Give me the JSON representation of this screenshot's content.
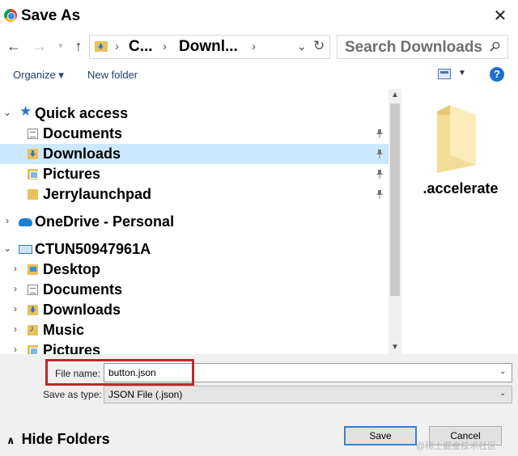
{
  "window": {
    "title": "Save As"
  },
  "address": {
    "crumbs": [
      "C...",
      "Downl..."
    ],
    "search_placeholder": "Search Downloads"
  },
  "toolbar": {
    "organize": "Organize ▾",
    "new_folder": "New folder"
  },
  "nav_tree": {
    "quick_access": "Quick access",
    "qa_items": [
      "Documents",
      "Downloads",
      "Pictures",
      "Jerrylaunchpad"
    ],
    "onedrive": "OneDrive - Personal",
    "pc": "CTUN50947961A",
    "pc_items": [
      "Desktop",
      "Documents",
      "Downloads",
      "Music",
      "Pictures"
    ]
  },
  "content": {
    "folder_name": ".accelerate"
  },
  "form": {
    "file_name_label": "File name:",
    "file_name_value": "button.json",
    "save_type_label": "Save as type:",
    "save_type_value": "JSON File (.json)"
  },
  "footer": {
    "hide_folders": "Hide Folders",
    "save": "Save",
    "cancel": "Cancel",
    "watermark": "@稀土掘金技术社区"
  },
  "colors": {
    "selection": "#cce8ff",
    "highlight_box": "#c0282a",
    "folder": "#e8c15a",
    "accent": "#1e6fd0"
  }
}
